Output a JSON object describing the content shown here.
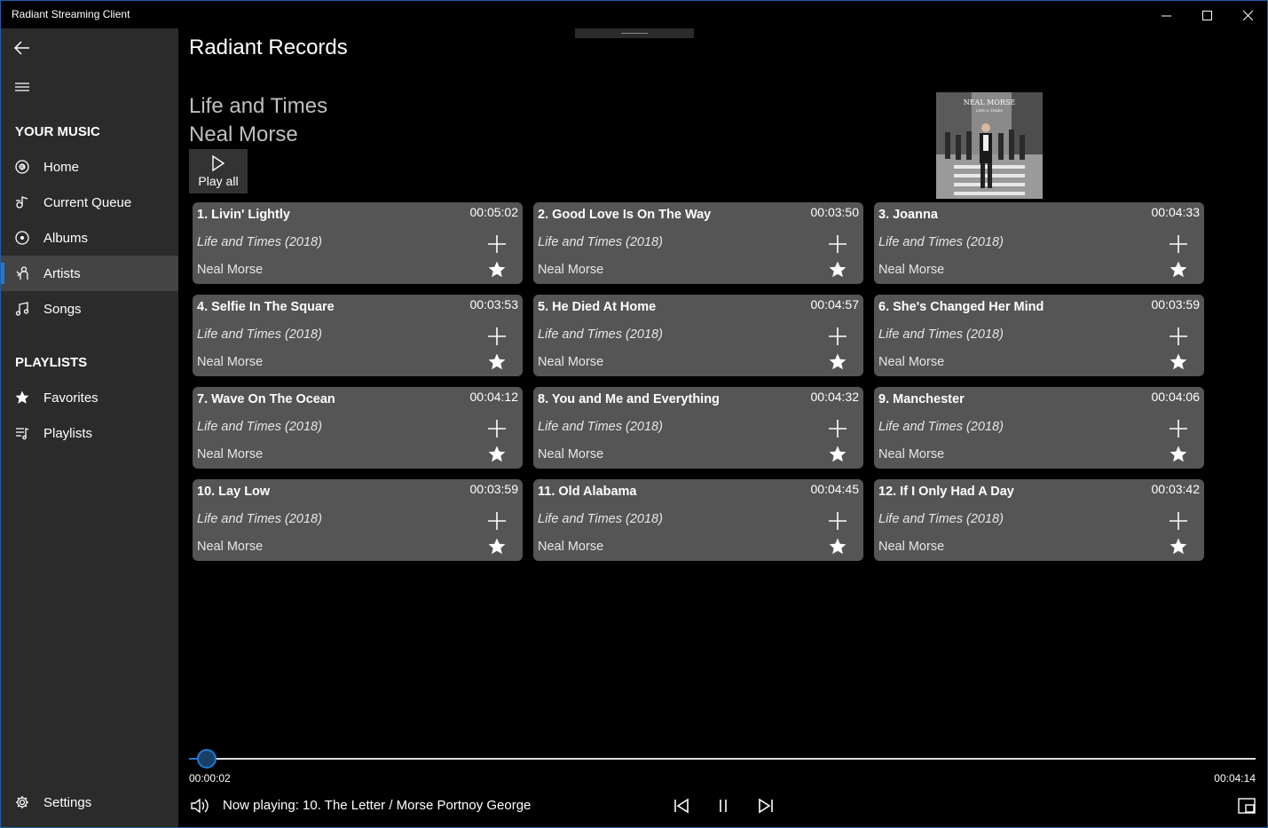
{
  "window": {
    "title": "Radiant Streaming Client",
    "accent": "#1f7ad6"
  },
  "sidebar": {
    "back_icon": "back-arrow-icon",
    "menu_icon": "hamburger-icon",
    "your_music_heading": "YOUR MUSIC",
    "music_items": [
      {
        "label": "Home",
        "icon": "home-icon"
      },
      {
        "label": "Current Queue",
        "icon": "queue-icon"
      },
      {
        "label": "Albums",
        "icon": "album-icon"
      },
      {
        "label": "Artists",
        "icon": "artist-icon",
        "selected": true
      },
      {
        "label": "Songs",
        "icon": "music-note-icon"
      }
    ],
    "playlists_heading": "PLAYLISTS",
    "playlist_items": [
      {
        "label": "Favorites",
        "icon": "star-icon"
      },
      {
        "label": "Playlists",
        "icon": "playlist-icon"
      }
    ],
    "settings_label": "Settings"
  },
  "main": {
    "page_title": "Radiant Records",
    "album_title": "Life and Times",
    "artist_name": "Neal Morse",
    "play_all_label": "Play all",
    "cover": {
      "line1": "NEAL MORSE",
      "line2": "LIFE & TIMES"
    }
  },
  "tracks": [
    {
      "title": "1. Livin' Lightly",
      "duration": "00:05:02",
      "album": "Life and Times (2018)",
      "artist": "Neal Morse"
    },
    {
      "title": "2. Good Love Is On The Way",
      "duration": "00:03:50",
      "album": "Life and Times (2018)",
      "artist": "Neal Morse"
    },
    {
      "title": "3. Joanna",
      "duration": "00:04:33",
      "album": "Life and Times (2018)",
      "artist": "Neal Morse"
    },
    {
      "title": "4. Selfie In The Square",
      "duration": "00:03:53",
      "album": "Life and Times (2018)",
      "artist": "Neal Morse"
    },
    {
      "title": "5. He Died At Home",
      "duration": "00:04:57",
      "album": "Life and Times (2018)",
      "artist": "Neal Morse"
    },
    {
      "title": "6. She's Changed Her Mind",
      "duration": "00:03:59",
      "album": "Life and Times (2018)",
      "artist": "Neal Morse"
    },
    {
      "title": "7. Wave On The Ocean",
      "duration": "00:04:12",
      "album": "Life and Times (2018)",
      "artist": "Neal Morse"
    },
    {
      "title": "8. You and Me and Everything",
      "duration": "00:04:32",
      "album": "Life and Times (2018)",
      "artist": "Neal Morse"
    },
    {
      "title": "9. Manchester",
      "duration": "00:04:06",
      "album": "Life and Times (2018)",
      "artist": "Neal Morse"
    },
    {
      "title": "10. Lay Low",
      "duration": "00:03:59",
      "album": "Life and Times (2018)",
      "artist": "Neal Morse"
    },
    {
      "title": "11. Old Alabama",
      "duration": "00:04:45",
      "album": "Life and Times (2018)",
      "artist": "Neal Morse"
    },
    {
      "title": "12. If I Only Had A Day",
      "duration": "00:03:42",
      "album": "Life and Times (2018)",
      "artist": "Neal Morse"
    }
  ],
  "player": {
    "current_time": "00:00:02",
    "total_time": "00:04:14",
    "progress_fraction": 0.008,
    "now_playing": "Now playing: 10. The Letter / Morse Portnoy George"
  }
}
